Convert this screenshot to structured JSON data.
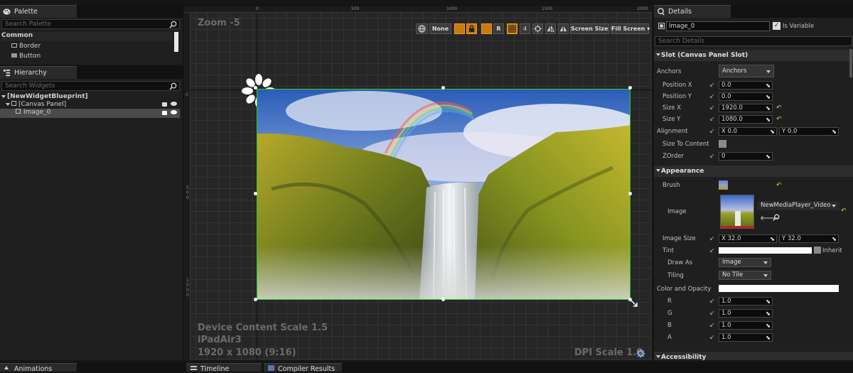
{
  "palette": {
    "tab_label": "Palette",
    "search_placeholder": "Search Palette",
    "category": "Common",
    "items": [
      {
        "label": "Border"
      },
      {
        "label": "Button"
      }
    ]
  },
  "hierarchy": {
    "tab_label": "Hierarchy",
    "search_placeholder": "Search Widgets",
    "root": "[NewWidgetBlueprint]",
    "canvas": "[Canvas Panel]",
    "selected": "Image_0"
  },
  "designer": {
    "zoom": "Zoom -5",
    "ruler_top": [
      "0",
      "500",
      "1000",
      "1500",
      "2000"
    ],
    "ruler_left": [
      "0",
      "5 0 0",
      "1 0 0 0"
    ],
    "toolbar": {
      "none_label": "None",
      "r_label": "R",
      "four_label": "4",
      "screen_size_label": "Screen Size",
      "fill_screen_label": "Fill Screen"
    },
    "device_scale": "Device Content Scale 1.5",
    "device_name": "iPadAir3",
    "resolution": "1920 x 1080 (9:16)",
    "dpi_scale": "DPI Scale 1.0"
  },
  "details": {
    "tab_label": "Details",
    "widget_name": "Image_0",
    "is_variable_label": "Is Variable",
    "search_placeholder": "Search Details",
    "slot_header": "Slot (Canvas Panel Slot)",
    "anchors_label": "Anchors",
    "anchors_value": "Anchors",
    "position_x_label": "Position X",
    "position_x": "0.0",
    "position_y_label": "Position Y",
    "position_y": "0.0",
    "size_x_label": "Size X",
    "size_x": "1920.0",
    "size_y_label": "Size Y",
    "size_y": "1080.0",
    "alignment_label": "Alignment",
    "alignment_x": "X  0.0",
    "alignment_y": "Y  0.0",
    "size_to_content_label": "Size To Content",
    "zorder_label": "ZOrder",
    "zorder": "0",
    "appearance_header": "Appearance",
    "brush_label": "Brush",
    "image_label": "Image",
    "image_asset": "NewMediaPlayer_Video",
    "image_size_label": "Image Size",
    "image_size_x": "X  32.0",
    "image_size_y": "Y  32.0",
    "tint_label": "Tint",
    "inherit_label": "Inherit",
    "draw_as_label": "Draw As",
    "draw_as_value": "Image",
    "tiling_label": "Tiling",
    "tiling_value": "No Tile",
    "color_opacity_label": "Color and Opacity",
    "r_label": "R",
    "r_value": "1.0",
    "g_label": "G",
    "g_value": "1.0",
    "b_label": "B",
    "b_value": "1.0",
    "a_label": "A",
    "a_value": "1.0",
    "accessibility_header": "Accessibility"
  },
  "bottom_tabs": {
    "animations": "Animations",
    "timeline": "Timeline",
    "compiler": "Compiler Results"
  }
}
